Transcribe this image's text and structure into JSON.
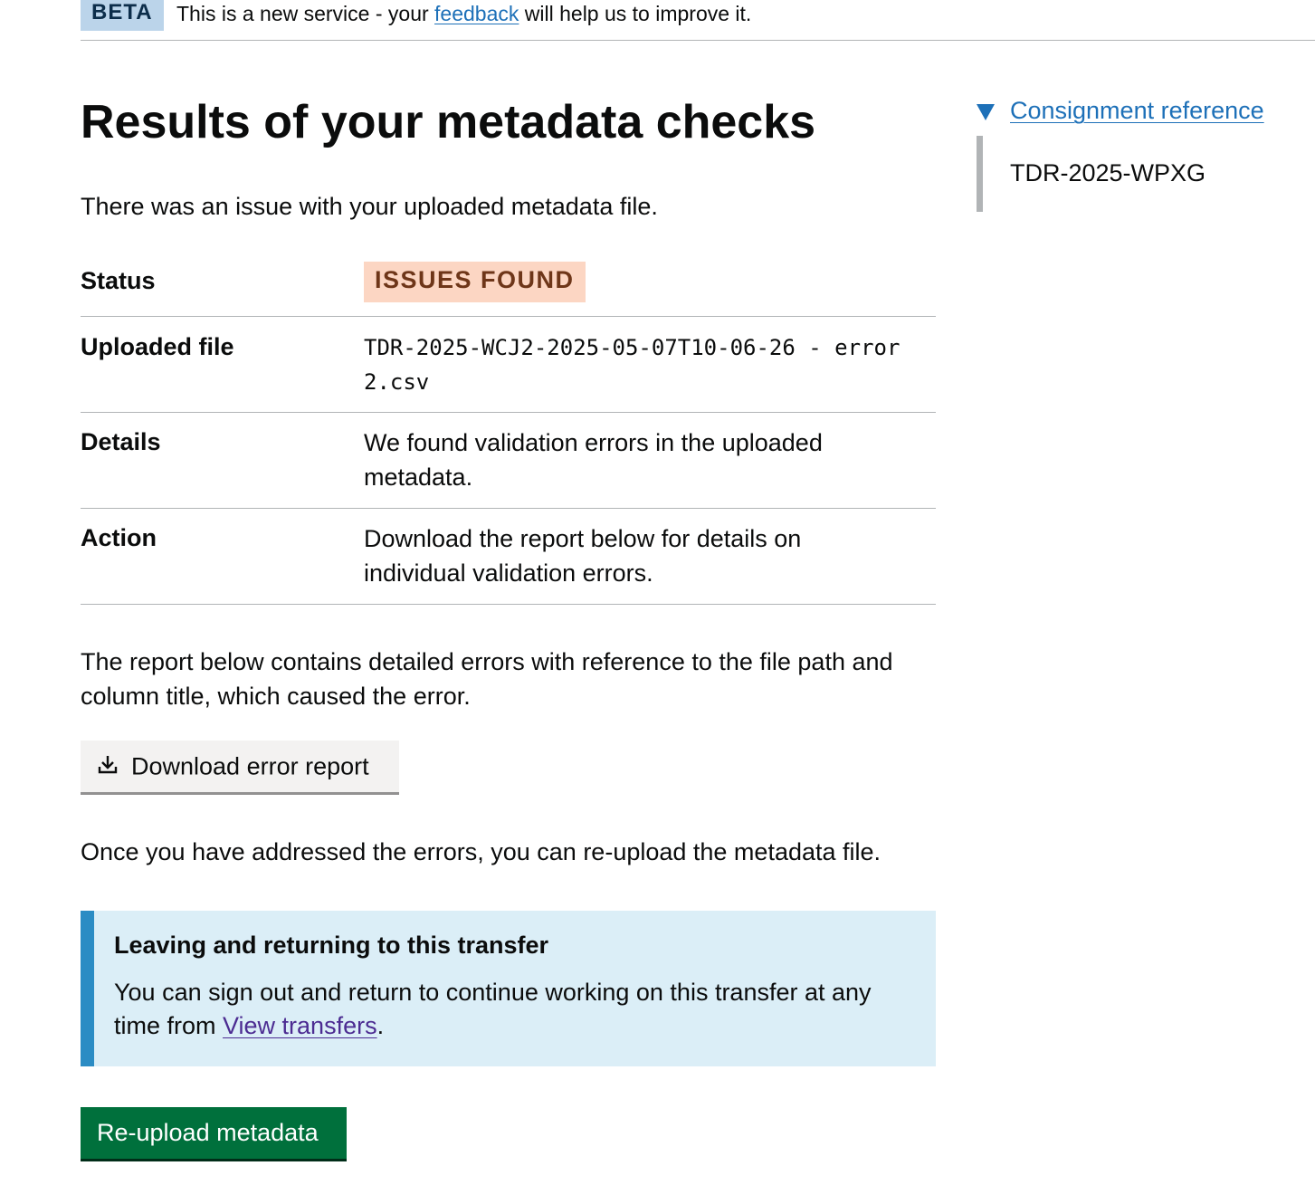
{
  "phase_banner": {
    "tag": "BETA",
    "text_before": "This is a new service - your ",
    "link": "feedback",
    "text_after": " will help us to improve it."
  },
  "page": {
    "title": "Results of your metadata checks",
    "intro": "There was an issue with your uploaded metadata file."
  },
  "summary": {
    "status_key": "Status",
    "status_value": "ISSUES FOUND",
    "file_key": "Uploaded file",
    "file_value": "TDR-2025-WCJ2-2025-05-07T10-06-26 - error 2.csv",
    "details_key": "Details",
    "details_value": "We found validation errors in the uploaded metadata.",
    "action_key": "Action",
    "action_value": "Download the report below for details on individual validation errors."
  },
  "report_text": "The report below contains detailed errors with reference to the file path and column title, which caused the error.",
  "download_button": {
    "label": "Download error report",
    "icon": "download-icon"
  },
  "readdress_text": "Once you have addressed the errors, you can re-upload the metadata file.",
  "inset": {
    "heading": "Leaving and returning to this transfer",
    "text_before": "You can sign out and return to continue working on this transfer at any time from ",
    "link": "View transfers",
    "text_after": "."
  },
  "reupload_button": {
    "label": "Re-upload metadata"
  },
  "sidebar": {
    "summary": "Consignment reference",
    "value": "TDR-2025-WPXG"
  },
  "colors": {
    "link": "#1d70b8",
    "visited_link": "#4c2c92",
    "primary_button": "#00703c",
    "issues_tag_bg": "#fcd6c3",
    "issues_tag_text": "#6e3619",
    "inset_border": "#2b8cc4"
  }
}
